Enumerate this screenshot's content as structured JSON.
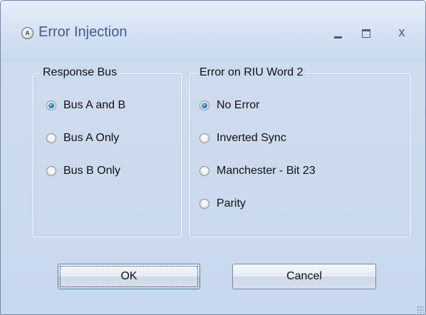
{
  "window": {
    "title": "Error Injection",
    "icon": "app-icon",
    "controls": {
      "minimize": "minimize-icon",
      "maximize": "maximize-icon",
      "close": "x"
    }
  },
  "response_bus": {
    "legend": "Response Bus",
    "options": [
      {
        "label": "Bus A and B",
        "checked": true
      },
      {
        "label": "Bus A Only",
        "checked": false
      },
      {
        "label": "Bus B Only",
        "checked": false
      }
    ]
  },
  "error_group": {
    "legend": "Error on RIU Word 2",
    "options": [
      {
        "label": "No Error",
        "checked": true
      },
      {
        "label": "Inverted Sync",
        "checked": false
      },
      {
        "label": "Manchester - Bit 23",
        "checked": false
      },
      {
        "label": "Parity",
        "checked": false
      }
    ]
  },
  "buttons": {
    "ok": "OK",
    "cancel": "Cancel"
  },
  "colors": {
    "title_text": "#3f5f8a",
    "window_bg": "#c8d8ee",
    "radio_selected": "#1f74c8"
  }
}
